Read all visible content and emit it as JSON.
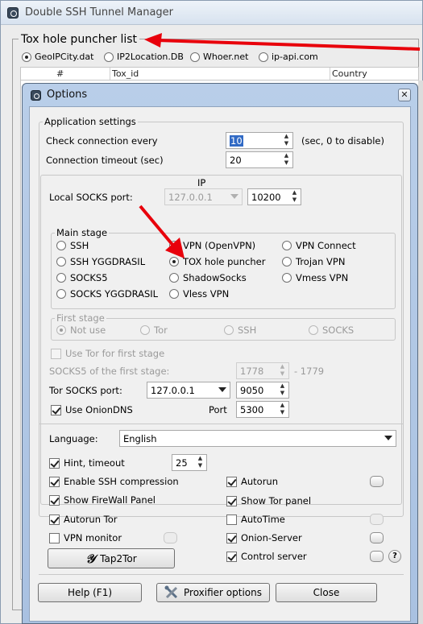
{
  "main_window": {
    "title": "Double SSH Tunnel Manager",
    "group_title": "Tox hole puncher list",
    "geo_sources": [
      {
        "label": "GeoIPCity.dat",
        "selected": true
      },
      {
        "label": "IP2Location.DB",
        "selected": false
      },
      {
        "label": "Whoer.net",
        "selected": false
      },
      {
        "label": "ip-api.com",
        "selected": false
      }
    ],
    "table_columns": [
      "#",
      "Tox_id",
      "Country"
    ]
  },
  "options": {
    "title": "Options",
    "close_glyph": "✕",
    "app_settings": {
      "label": "Application settings",
      "check_label": "Check connection every",
      "check_value": "10",
      "check_hint": "(sec, 0 to disable)",
      "timeout_label": "Connection timeout (sec)",
      "timeout_value": "20"
    },
    "socks": {
      "ip_header": "IP",
      "local_label": "Local SOCKS port:",
      "local_ip": "127.0.0.1",
      "local_port": "10200"
    },
    "main_stage": {
      "label": "Main stage",
      "options": [
        "SSH",
        "VPN (OpenVPN)",
        "VPN Connect",
        "SSH YGGDRASIL",
        "TOX hole puncher",
        "Trojan VPN",
        "SOCKS5",
        "ShadowSocks",
        "Vmess VPN",
        "SOCKS YGGDRASIL",
        "Vless VPN"
      ],
      "selected": "TOX hole puncher"
    },
    "first_stage": {
      "label": "First stage",
      "options": [
        "Not use",
        "Tor",
        "SSH",
        "SOCKS"
      ],
      "selected": "Not use"
    },
    "tor": {
      "use_tor_first": "Use Tor for first stage",
      "socks5_first_label": "SOCKS5 of the first stage:",
      "socks5_first_value": "1778",
      "socks5_first_range": "- 1779",
      "tor_socks_label": "Tor SOCKS port:",
      "tor_socks_ip": "127.0.0.1",
      "tor_socks_port": "9050",
      "use_onion_dns": "Use OnionDNS",
      "port_label": "Port",
      "dns_port": "5300"
    },
    "language": {
      "label": "Language:",
      "value": "English"
    },
    "hint_label": "Hint, timeout",
    "hint_value": "25",
    "checks_left": [
      {
        "label": "Enable SSH compression",
        "checked": true
      },
      {
        "label": "Show FireWall Panel",
        "checked": true
      },
      {
        "label": "Autorun Tor",
        "checked": true
      },
      {
        "label": "VPN monitor",
        "checked": false
      }
    ],
    "checks_right": [
      {
        "label": "Autorun",
        "checked": true
      },
      {
        "label": "Show Tor panel",
        "checked": true
      },
      {
        "label": "AutoTime",
        "checked": false
      },
      {
        "label": "Onion-Server",
        "checked": true
      },
      {
        "label": "Control server",
        "checked": true
      }
    ],
    "help_glyph": "?",
    "tap2tor_label": "Tap2Tor",
    "buttons": {
      "help": "Help (F1)",
      "proxifier": "Proxifier options",
      "close": "Close"
    }
  },
  "colors": {
    "annotation_arrow": "#e8000b",
    "selection": "#316ac5"
  }
}
